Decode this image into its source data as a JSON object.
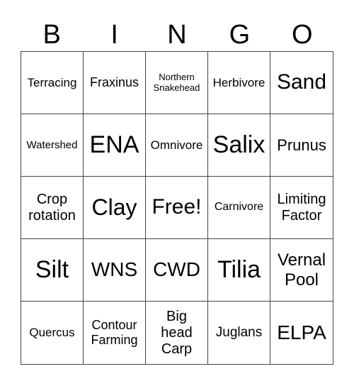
{
  "header": [
    "B",
    "I",
    "N",
    "G",
    "O"
  ],
  "cells": [
    "Terracing",
    "Fraxinus",
    "Northern\nSnakehead",
    "Herbivore",
    "Sand",
    "Watershed",
    "ENA",
    "Omnivore",
    "Salix",
    "Prunus",
    "Crop\nrotation",
    "Clay",
    "Free!",
    "Carnivore",
    "Limiting\nFactor",
    "Silt",
    "WNS",
    "CWD",
    "Tilia",
    "Vernal\nPool",
    "Quercus",
    "Contour\nFarming",
    "Big\nhead\nCarp",
    "Juglans",
    "ELPA"
  ]
}
